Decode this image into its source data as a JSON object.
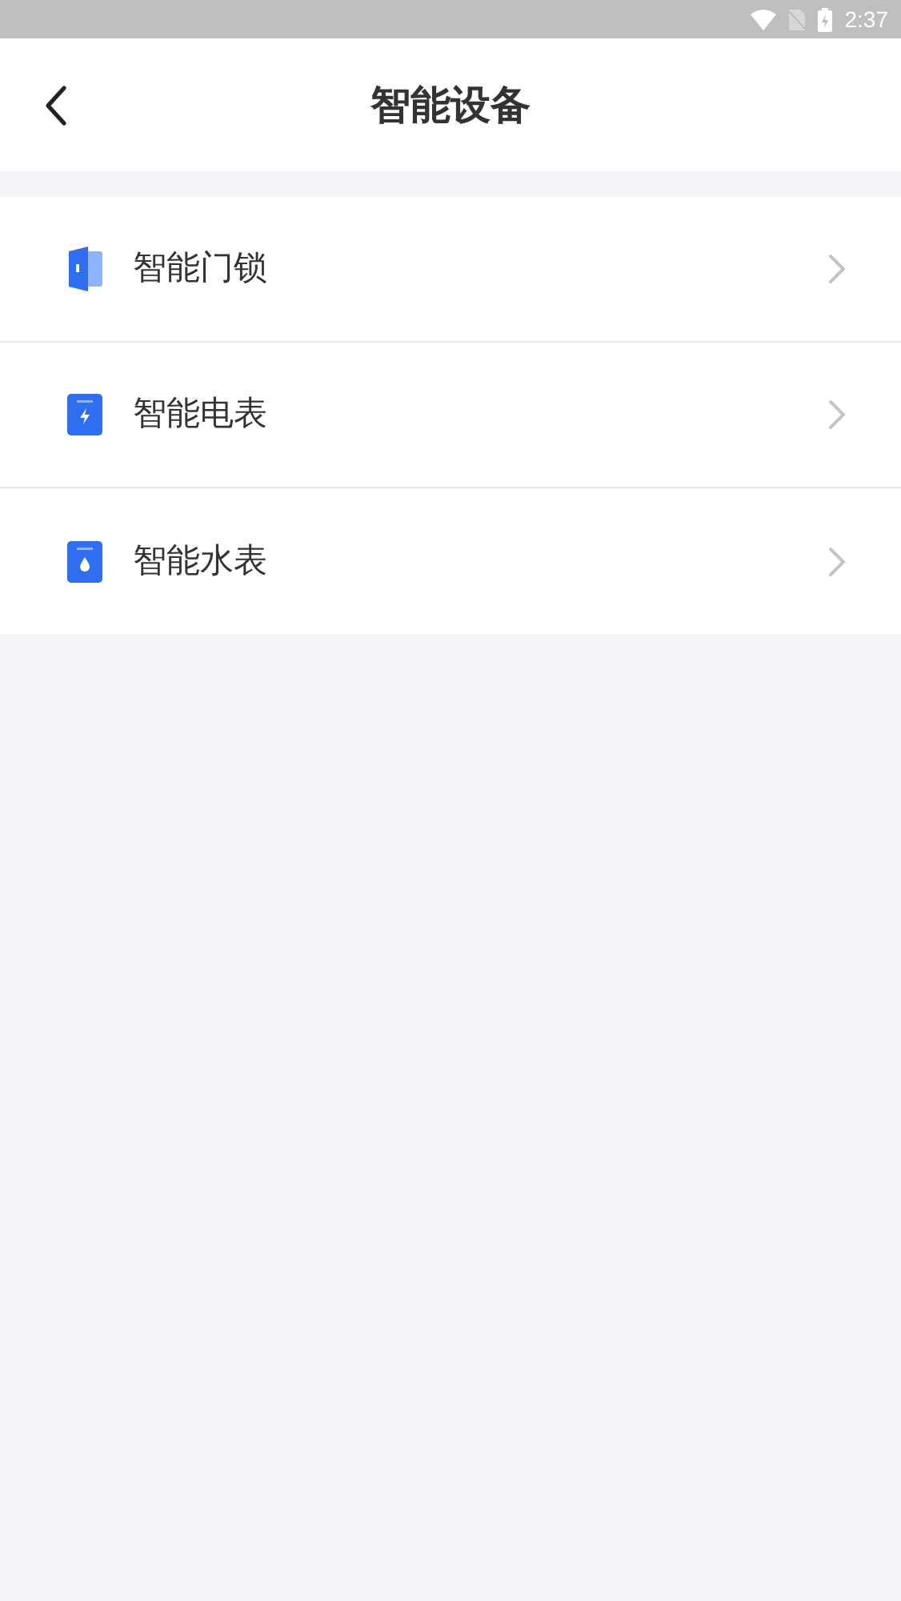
{
  "status_bar": {
    "time": "2:37"
  },
  "header": {
    "title": "智能设备"
  },
  "devices": [
    {
      "kind": "lock",
      "label": "智能门锁"
    },
    {
      "kind": "electric",
      "label": "智能电表"
    },
    {
      "kind": "water",
      "label": "智能水表"
    }
  ]
}
